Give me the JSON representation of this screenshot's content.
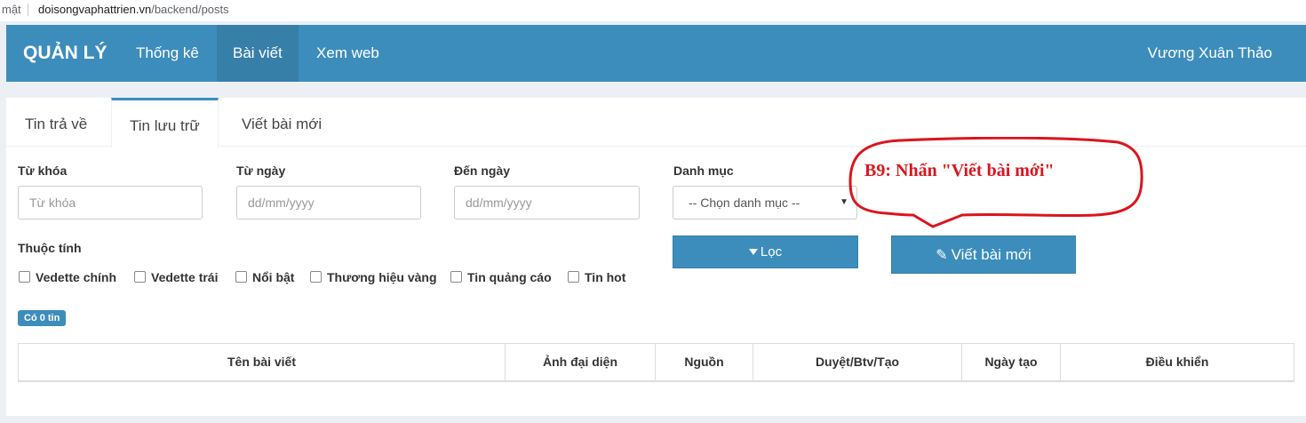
{
  "browser": {
    "prefix": "mật",
    "host": "doisongvaphattrien.vn",
    "path": "/backend/posts"
  },
  "navbar": {
    "brand": "QUẢN LÝ",
    "items": [
      {
        "label": "Thống kê"
      },
      {
        "label": "Bài viết"
      },
      {
        "label": "Xem web"
      }
    ],
    "user": "Vương Xuân Thảo",
    "color": "#3c8dbc"
  },
  "tabs": [
    {
      "label": "Tin trả về"
    },
    {
      "label": "Tin lưu trữ"
    },
    {
      "label": "Viết bài mới"
    }
  ],
  "filters": {
    "keyword_label": "Từ khóa",
    "keyword_placeholder": "Từ khóa",
    "from_label": "Từ ngày",
    "from_placeholder": "dd/mm/yyyy",
    "to_label": "Đến ngày",
    "to_placeholder": "dd/mm/yyyy",
    "category_label": "Danh mục",
    "category_value": "-- Chọn danh mục --",
    "attr_label": "Thuộc tính",
    "checkboxes": [
      {
        "label": "Vedette chính"
      },
      {
        "label": "Vedette trái"
      },
      {
        "label": "Nổi bật"
      },
      {
        "label": "Thương hiệu vàng"
      },
      {
        "label": "Tin quảng cáo"
      },
      {
        "label": "Tin hot"
      }
    ],
    "filter_button": "Lọc",
    "new_post_button": "Viết bài mới"
  },
  "count_badge": "Có 0 tin",
  "table": {
    "columns": [
      "Tên bài viết",
      "Ảnh đại diện",
      "Nguồn",
      "Duyệt/Btv/Tạo",
      "Ngày tạo",
      "Điều khiển"
    ]
  },
  "annotation": {
    "text": "B9: Nhấn \"Viết bài mới\"",
    "color": "#d9161e"
  }
}
